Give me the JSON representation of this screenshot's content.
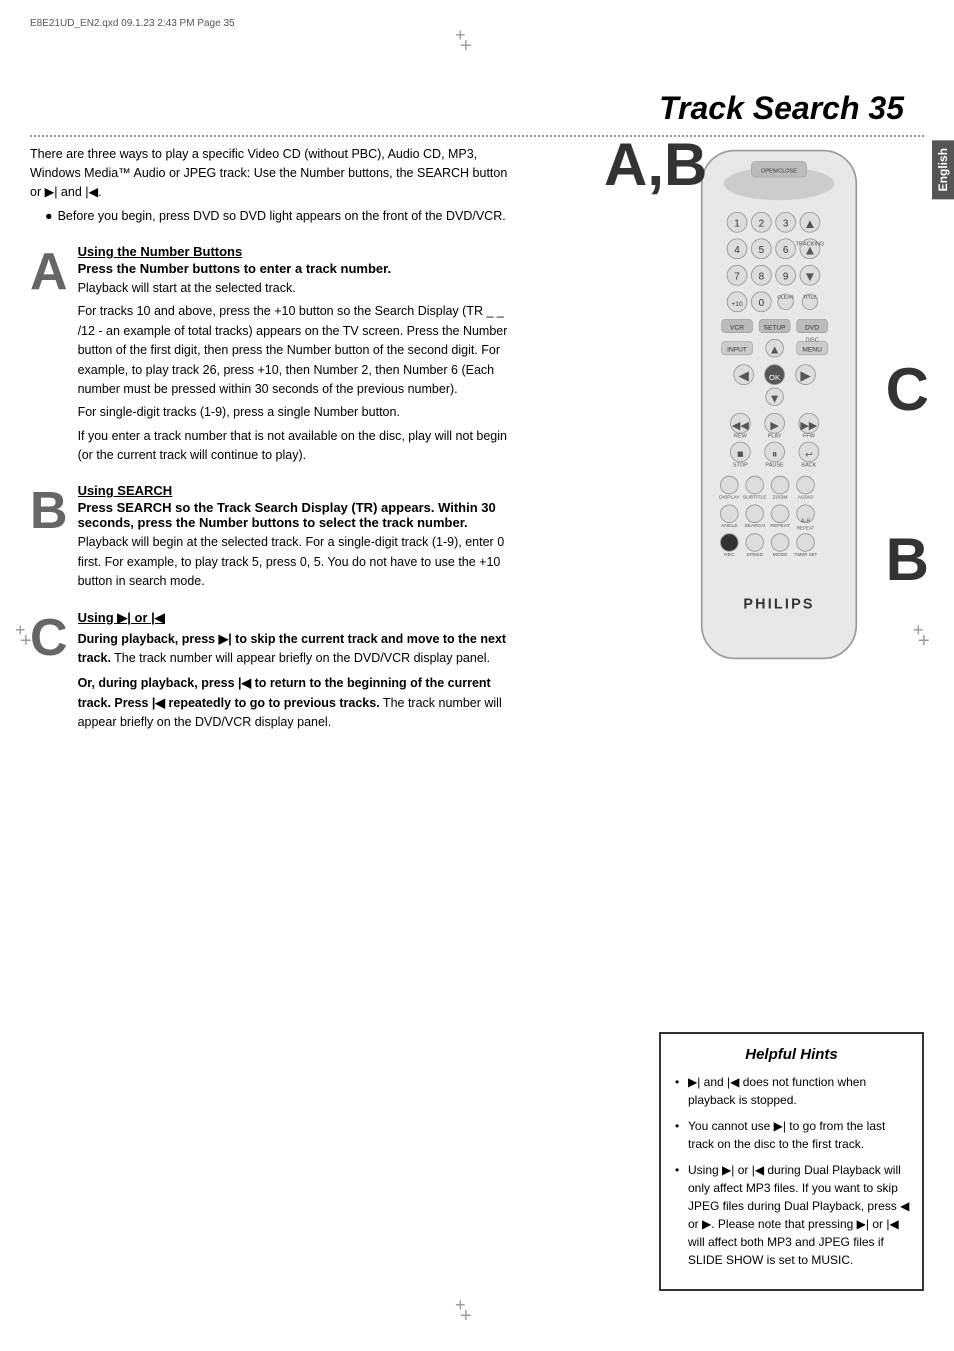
{
  "file_header": "E8E21UD_EN2.qxd   09.1.23   2:43 PM   Page 35",
  "page_title": "Track Search  35",
  "english_tab": "English",
  "intro_text": "There are three ways to play a specific Video CD (without PBC), Audio CD, MP3, Windows Media™ Audio or JPEG track: Use the Number buttons, the SEARCH button or ▶| and |◀.",
  "bullet_text": "Before you begin, press DVD so DVD light appears on the front of the DVD/VCR.",
  "section_a": {
    "letter": "A",
    "heading": "Using the Number Buttons",
    "subheading": "Press the Number buttons to enter a track number.",
    "text1": "Playback will start at the selected track.",
    "text2": "For tracks 10 and above, press the +10 button so the Search Display (TR _ _ /12 - an example of total tracks)  appears on the TV screen. Press the Number button of the first digit, then press the Number button of the second digit. For example, to play track 26, press +10, then Number 2, then Number 6 (Each number must be pressed within 30 seconds of the previous number).",
    "text3": "For single-digit tracks (1-9), press a single Number button.",
    "text4": "If you enter a track number that is not available on the disc, play will not begin (or the current track will continue to play)."
  },
  "section_b": {
    "letter": "B",
    "heading": "Using SEARCH",
    "subheading": "Press SEARCH so the Track Search Display (TR) appears. Within 30 seconds, press the Number buttons to select the track number.",
    "text1": "Playback will begin at the selected track. For a single-digit track (1-9), enter 0 first. For example, to play track 5, press 0, 5.  You do not have to use the +10 button in search mode."
  },
  "section_c": {
    "letter": "C",
    "heading": "Using ▶| or |◀",
    "para1_bold": "During playback, press ▶| to skip the current track and move to the next track.",
    "para1_normal": " The track number will appear briefly on the DVD/VCR display panel.",
    "para2_bold": "Or, during playback, press |◀ to return to the beginning of the current track. Press |◀ repeatedly to go to previous tracks.",
    "para2_normal": " The track number will appear briefly on the DVD/VCR display panel."
  },
  "overlay_labels": {
    "ab": "A,B",
    "c_right": "C",
    "b_right": "B"
  },
  "helpful_hints": {
    "title": "Helpful Hints",
    "items": [
      "▶| and |◀ does not function when playback is stopped.",
      "You cannot use ▶| to go from the last track on the disc to the first track.",
      "Using ▶| or |◀ during Dual Playback will only affect MP3 files. If you want to skip JPEG files during Dual Playback, press ◀ or ▶. Please note that pressing ▶| or |◀ will affect both MP3 and JPEG files if SLIDE SHOW is set to MUSIC."
    ]
  }
}
